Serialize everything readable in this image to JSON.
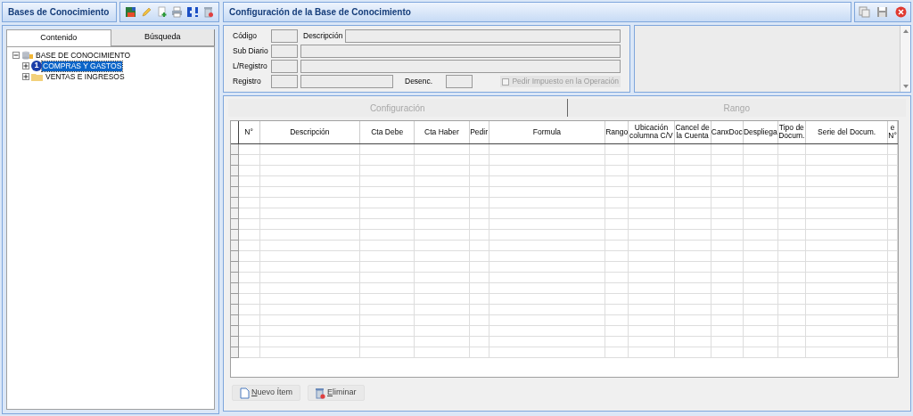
{
  "left_panel": {
    "title": "Bases de Conocimiento",
    "tabs": [
      {
        "label": "Contenido",
        "selected": true
      },
      {
        "label": "Búsqueda",
        "selected": false
      }
    ],
    "tree": [
      {
        "label": "BASE DE CONOCIMIENTO",
        "expanded": true,
        "selected": false,
        "children": [
          {
            "label": "COMPRAS Y GASTOS",
            "expanded": false,
            "selected": true,
            "badge": "1"
          },
          {
            "label": "VENTAS E INGRESOS",
            "expanded": false,
            "selected": false
          }
        ]
      }
    ]
  },
  "main_panel": {
    "title": "Configuración de la Base de Conocimiento",
    "form": {
      "codigo_label": "Código",
      "descripcion_label": "Descripción",
      "sub_diario_label": "Sub Diario",
      "l_registro_label": "L/Registro",
      "registro_label": "Registro",
      "desenc_label": "Desenc.",
      "checkbox": {
        "label": "Pedir Impuesto en la Operación",
        "checked": false,
        "disabled": true
      }
    },
    "grid_tabs": [
      {
        "label": "Configuración",
        "selected": false
      },
      {
        "label": "Rango",
        "selected": false
      }
    ],
    "table": {
      "columns": [
        "N°",
        "Descripción",
        "Cta Debe",
        "Cta Haber",
        "Pedir",
        "Formula",
        "Rango",
        "Ubicación columna C/V",
        "Cancel de la Cuenta",
        "CanxDoc",
        "Despliega",
        "Tipo de Docum.",
        "Serie del Docum.",
        "e N°"
      ]
    },
    "buttons": [
      {
        "kind": "new",
        "label": "Nuevo Ítem",
        "shortcut_underlined": true
      },
      {
        "kind": "delete",
        "label": "Eliminar",
        "shortcut_underlined": true
      }
    ]
  }
}
